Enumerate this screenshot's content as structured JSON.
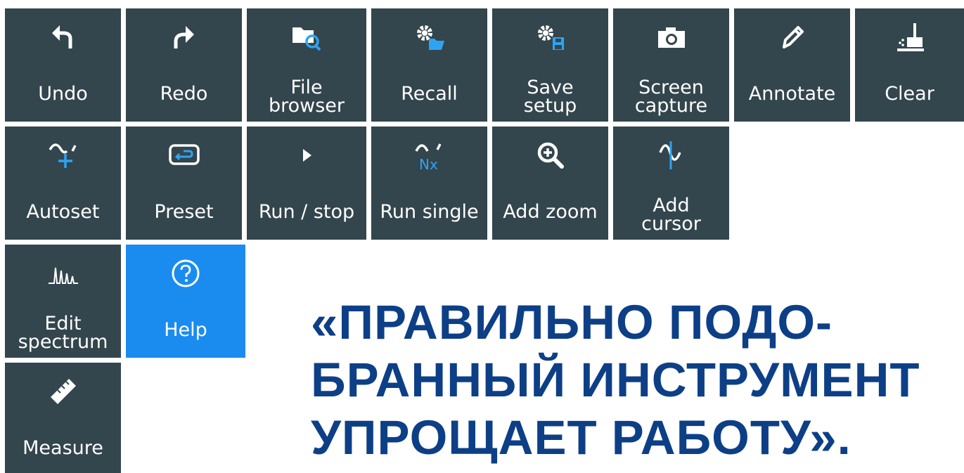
{
  "toolbar": {
    "undo": "Undo",
    "redo": "Redo",
    "file_browser": "File\nbrowser",
    "recall": "Recall",
    "save_setup": "Save\nsetup",
    "screen_capture": "Screen\ncapture",
    "annotate": "Annotate",
    "clear": "Clear",
    "autoset": "Autoset",
    "preset": "Preset",
    "run_stop": "Run / stop",
    "run_single": "Run single",
    "run_single_glyph": "Nx",
    "add_zoom": "Add zoom",
    "add_cursor": "Add\ncursor",
    "edit_spectrum": "Edit\nspectrum",
    "help": "Help",
    "measure": "Measure"
  },
  "quote": {
    "line1": "«ПРАВИЛЬНО ПОДО-",
    "line2": "БРАННЫЙ ИНСТРУМЕНТ",
    "line3": "УПРОЩАЕТ РАБОТУ»."
  },
  "colors": {
    "tile": "#33454d",
    "tile_active": "#1a8cf0",
    "icon_blue": "#2ea3f2",
    "quote_text": "#0d3f87"
  },
  "icons": {
    "undo": "undo-arrow-icon",
    "redo": "redo-arrow-icon",
    "file_browser": "folder-search-icon",
    "recall": "gear-folder-icon",
    "save_setup": "gear-save-icon",
    "screen_capture": "camera-icon",
    "annotate": "pencil-icon",
    "clear": "broom-icon",
    "autoset": "autoset-icon",
    "preset": "preset-icon",
    "run_stop": "play-icon",
    "run_single": "run-single-icon",
    "add_zoom": "zoom-in-icon",
    "add_cursor": "cursor-icon",
    "edit_spectrum": "spectrum-icon",
    "help": "help-circle-icon",
    "measure": "ruler-icon"
  }
}
